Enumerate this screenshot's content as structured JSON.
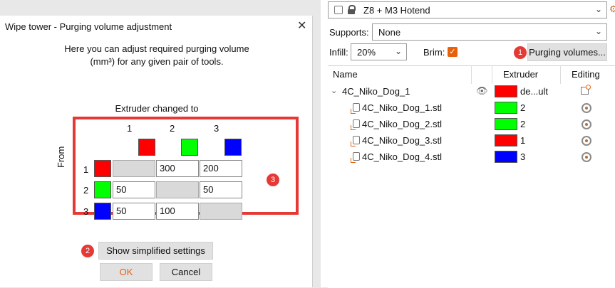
{
  "dialog": {
    "title": "Wipe tower - Purging volume adjustment",
    "close_glyph": "✕",
    "description_line1": "Here you can adjust required purging volume",
    "description_line2": "(mm³) for any given pair of tools.",
    "extruder_changed_to": "Extruder changed to",
    "from_label": "From",
    "columns": [
      {
        "label": "1",
        "color": "#ff0000"
      },
      {
        "label": "2",
        "color": "#00ff00"
      },
      {
        "label": "3",
        "color": "#0000ff"
      }
    ],
    "rows": [
      {
        "label": "1",
        "color": "#ff0000",
        "cells": [
          "",
          "300",
          "200"
        ]
      },
      {
        "label": "2",
        "color": "#00ff00",
        "cells": [
          "50",
          "",
          "50"
        ]
      },
      {
        "label": "3",
        "color": "#0000ff",
        "cells": [
          "50",
          "100",
          ""
        ]
      }
    ],
    "show_simplified_label": "Show simplified settings",
    "ok_label": "OK",
    "cancel_label": "Cancel",
    "badge_2": "2",
    "badge_3": "3"
  },
  "panel": {
    "printer": "Z8 + M3 Hotend",
    "supports_label": "Supports:",
    "supports_value": "None",
    "infill_label": "Infill:",
    "infill_value": "20%",
    "brim_label": "Brim:",
    "brim_checked": true,
    "badge_1": "1",
    "purging_button": "Purging volumes...",
    "headers": {
      "name": "Name",
      "extruder": "Extruder",
      "editing": "Editing"
    },
    "object": {
      "name": "4C_Niko_Dog_1",
      "extruder": "de...ult",
      "color": "#ff0000"
    },
    "parts": [
      {
        "name": "4C_Niko_Dog_1.stl",
        "extruder": "2",
        "color": "#00ff00"
      },
      {
        "name": "4C_Niko_Dog_2.stl",
        "extruder": "2",
        "color": "#00ff00"
      },
      {
        "name": "4C_Niko_Dog_3.stl",
        "extruder": "1",
        "color": "#ff0000"
      },
      {
        "name": "4C_Niko_Dog_4.stl",
        "extruder": "3",
        "color": "#0000ff"
      }
    ]
  }
}
